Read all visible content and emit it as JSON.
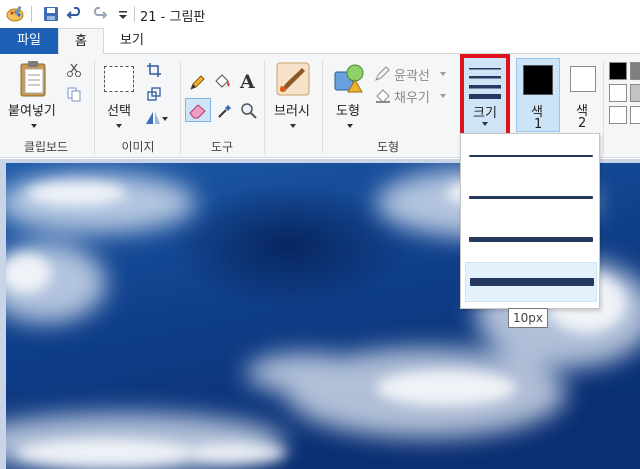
{
  "window": {
    "title": "21 - 그림판"
  },
  "quick_access": {
    "icons": [
      "paint-app-icon",
      "save-icon",
      "undo-icon",
      "redo-icon",
      "customize-dropdown-icon"
    ]
  },
  "tabs": [
    {
      "label": "파일",
      "active": false
    },
    {
      "label": "홈",
      "active": true
    },
    {
      "label": "보기",
      "active": false
    }
  ],
  "ribbon": {
    "clipboard": {
      "paste_label": "붙여넣기",
      "group_label": "클립보드"
    },
    "image": {
      "select_label": "선택",
      "group_label": "이미지"
    },
    "tools": {
      "group_label": "도구"
    },
    "brushes": {
      "label": "브러시"
    },
    "shapes": {
      "shape_label": "도형",
      "outline_label": "윤곽선",
      "fill_label": "채우기",
      "group_label": "도형"
    },
    "size": {
      "label": "크기"
    },
    "color1": {
      "label_line1": "색",
      "label_line2": "1",
      "value": "#000000"
    },
    "color2": {
      "label_line1": "색",
      "label_line2": "2",
      "value": "#ffffff"
    },
    "palette": [
      "#000000",
      "#ffffff",
      "#7f7f7f",
      "#c3c3c3",
      "#ffffff",
      "#ffffff"
    ]
  },
  "size_dropdown": {
    "options": [
      {
        "label": "1px",
        "selected": false
      },
      {
        "label": "3px",
        "selected": false
      },
      {
        "label": "5px",
        "selected": false
      },
      {
        "label": "10px",
        "selected": true
      }
    ],
    "tooltip": "10px"
  },
  "colors": {
    "file_tab": "#1d5fb4",
    "highlight_border": "#e0121e",
    "line_color": "#25395e"
  }
}
